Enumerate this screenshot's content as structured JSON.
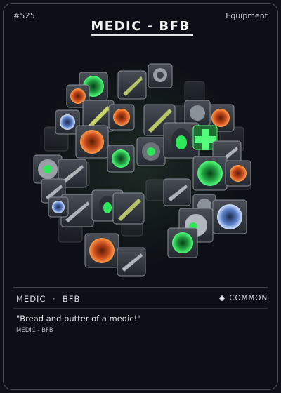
{
  "card": {
    "number": "#525",
    "category": "Equipment",
    "title": "MEDIC - BFB",
    "name": "MEDIC",
    "separator": "·",
    "subname": "BFB",
    "rarity": "COMMON",
    "rarity_icon": "diamond-icon",
    "flavor_text": "\"Bread and butter of a medic!\"",
    "flavor_source": "MEDIC - BFB"
  },
  "art": {
    "description_icon": "equipment-collage-image",
    "colors": {
      "background": "#0c0f15",
      "accent_green": "#2ee65a",
      "accent_orange": "#e0642a",
      "accent_blue": "#8ab4ff"
    },
    "tiles": [
      {
        "kind": "orange-ring-gem",
        "name": "tile-orange-gem"
      },
      {
        "kind": "green-ring-gem",
        "name": "tile-green-gem"
      },
      {
        "kind": "blade",
        "name": "tile-blade"
      },
      {
        "kind": "rifle",
        "name": "tile-rifle"
      },
      {
        "kind": "grenade",
        "name": "tile-grenade"
      },
      {
        "kind": "helmet",
        "name": "tile-helmet"
      },
      {
        "kind": "blue-ring-gem",
        "name": "tile-blue-gem"
      },
      {
        "kind": "medic-backpack",
        "name": "tile-medic-backpack"
      },
      {
        "kind": "green-cross",
        "name": "tile-green-cross"
      }
    ]
  }
}
